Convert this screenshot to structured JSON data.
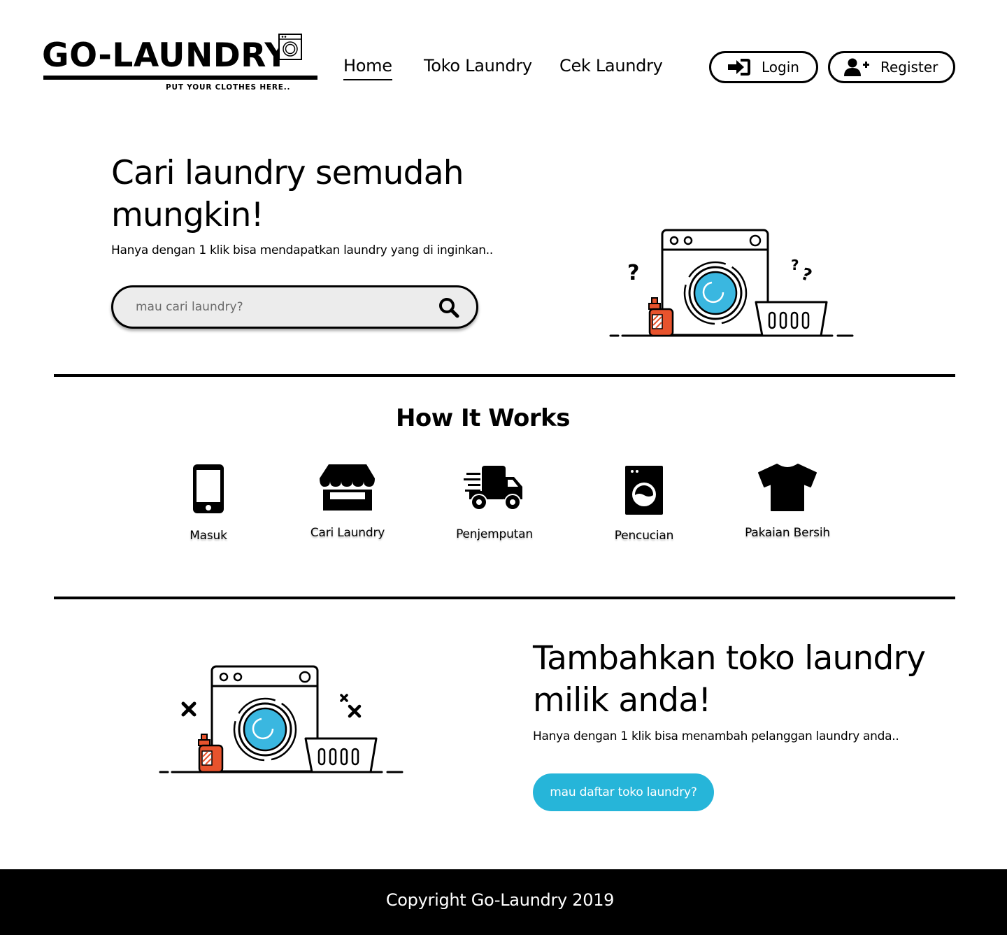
{
  "header": {
    "logo_text": "GO-LAUNDRY",
    "logo_tagline": "PUT YOUR CLOTHES HERE..",
    "nav": [
      {
        "label": "Home",
        "active": true
      },
      {
        "label": "Toko Laundry",
        "active": false
      },
      {
        "label": "Cek Laundry",
        "active": false
      }
    ],
    "login_label": "Login",
    "register_label": "Register",
    "login_icon": "sign-in-icon",
    "register_icon": "user-plus-icon"
  },
  "hero": {
    "title": "Cari laundry semudah mungkin!",
    "subtitle": "Hanya dengan 1 klik bisa mendapatkan laundry yang di inginkan..",
    "search_placeholder": "mau cari laundry?",
    "search_value": "",
    "search_icon": "search-icon"
  },
  "how_it_works": {
    "title": "How It Works",
    "steps": [
      {
        "label": "Masuk",
        "icon": "smartphone-icon"
      },
      {
        "label": "Cari Laundry",
        "icon": "store-icon"
      },
      {
        "label": "Penjemputan",
        "icon": "delivery-truck-icon"
      },
      {
        "label": "Pencucian",
        "icon": "washing-machine-icon"
      },
      {
        "label": "Pakaian Bersih",
        "icon": "t-shirt-icon"
      }
    ]
  },
  "add_store": {
    "title": "Tambahkan toko laundry milik anda!",
    "subtitle": "Hanya dengan 1 klik bisa menambah pelanggan laundry anda..",
    "button_label": "mau daftar toko laundry?"
  },
  "footer": {
    "copyright": "Copyright Go-Laundry 2019"
  },
  "colors": {
    "accent": "#26b5d9",
    "drum_blue": "#3ab7e0",
    "detergent_orange": "#e8532d",
    "search_bg": "#ececec",
    "footer_bg": "#000000"
  }
}
